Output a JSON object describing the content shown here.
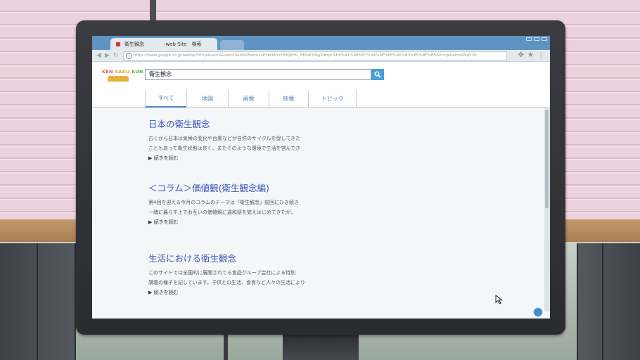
{
  "browser": {
    "tab_title": "衛生観念　　　　-web Site　検索",
    "url": "https://www.google.co.jp/webhp?hl=ja&sa=X&ved=0ahUKEwicncaPYbOAhXHFIQKHU_8E0AQPAgD#q=%E8%A1%9B%E7%94%9F%E8%A6%B3%E5%BF%B5&hl=ja&ei=oRSpV2h"
  },
  "site": {
    "logo": [
      "KEN ",
      "SAKU ",
      "KUN"
    ],
    "search_query": "衛生観念"
  },
  "nav_tabs": [
    {
      "label": "すべて",
      "active": true
    },
    {
      "label": "地図",
      "active": false
    },
    {
      "label": "画像",
      "active": false
    },
    {
      "label": "映像",
      "active": false
    },
    {
      "label": "トピック",
      "active": false
    }
  ],
  "results": [
    {
      "title": "日本の衛生観念",
      "line1": "古くから日本は気候の変化や台風などが自然のサイクルを促してきた",
      "line2": "こともあって衛生状態は良く、またそのような環境で生活を営んでき",
      "more": "▶ 続きを読む"
    },
    {
      "title": "＜コラム＞価値観(衛生観念編)",
      "line1": "第4回を迎える今月のコラムのテーマは「衛生観念」前回にひき続き",
      "line2": "一緒に暮らす上でお互いの価値観に違和感を覚えはじめてきたが、",
      "more": "▶ 続きを読む"
    },
    {
      "title": "生活における衛生観念",
      "line1": "このサイトでは全国的に展開されてる食品グループ会社による特別",
      "line2": "講義の様子を記しています。子供との生活、食育など人々の生活により",
      "more": "▶ 続きを読む"
    }
  ],
  "colors": {
    "accent": "#4a86bf",
    "link": "#3a56b8",
    "tabbar": "#5f93c4"
  },
  "icons": [
    "back-icon",
    "forward-icon",
    "reload-icon",
    "info-icon",
    "extension-icon",
    "star-icon",
    "menu-icon",
    "search-icon",
    "cursor-icon"
  ]
}
